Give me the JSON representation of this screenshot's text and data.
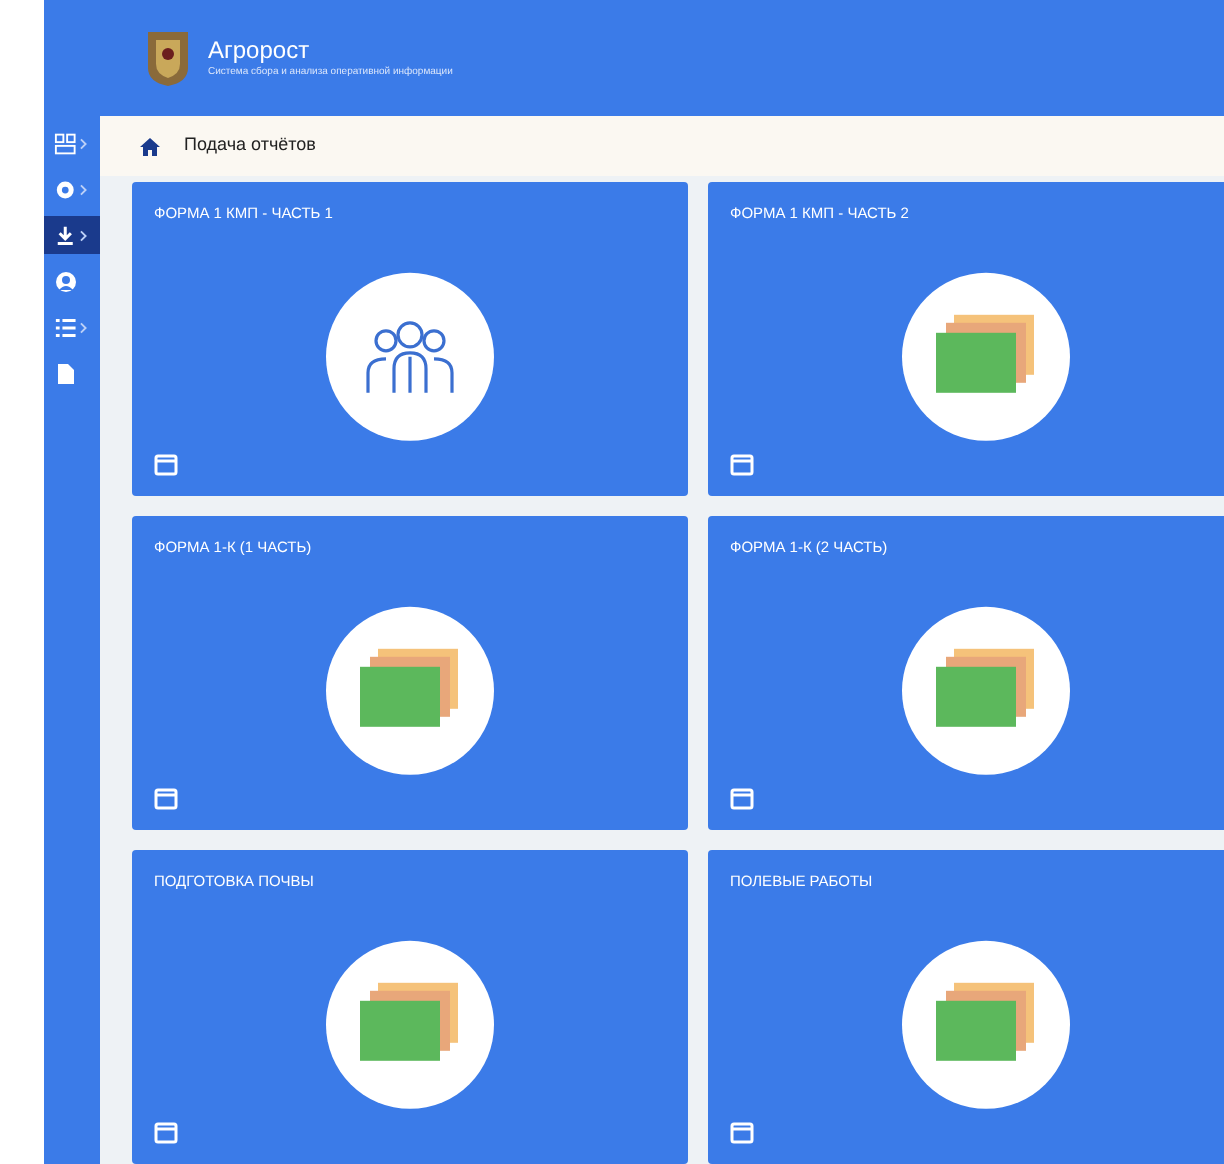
{
  "header": {
    "title": "Агророст",
    "subtitle": "Система сбора и анализа оперативной информации"
  },
  "sidebar": {
    "items": [
      {
        "selected": false,
        "expandable": true
      },
      {
        "selected": false,
        "expandable": true
      },
      {
        "selected": true,
        "expandable": true
      },
      {
        "selected": false,
        "expandable": false
      },
      {
        "selected": false,
        "expandable": true
      },
      {
        "selected": false,
        "expandable": false
      }
    ]
  },
  "breadcrumb": {
    "current": "Подача отчётов"
  },
  "cards": [
    {
      "title": "ФОРМА 1 КМП - ЧАСТЬ 1",
      "kind": "people"
    },
    {
      "title": "ФОРМА 1 КМП - ЧАСТЬ 2",
      "kind": "papers"
    },
    {
      "title": "ФОРМА 1-К (1 ЧАСТЬ)",
      "kind": "papers"
    },
    {
      "title": "ФОРМА 1-К (2 ЧАСТЬ)",
      "kind": "papers"
    },
    {
      "title": "ПОДГОТОВКА ПОЧВЫ",
      "kind": "papers"
    },
    {
      "title": "ПОЛЕВЫЕ РАБОТЫ",
      "kind": "papers"
    }
  ]
}
